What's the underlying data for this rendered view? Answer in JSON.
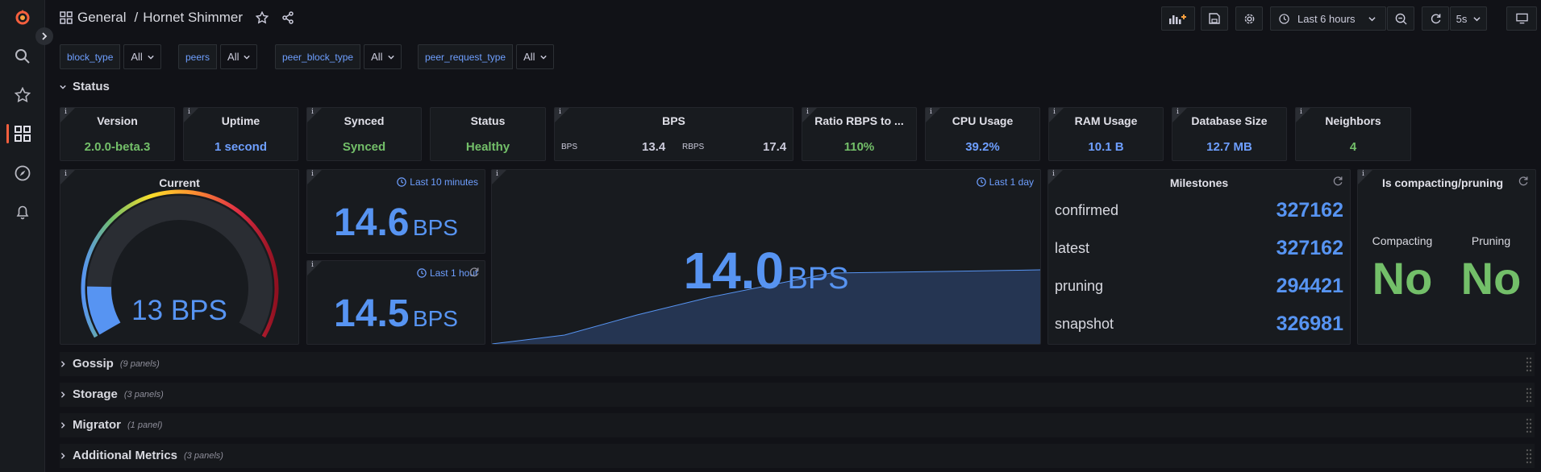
{
  "breadcrumb": {
    "folder": "General",
    "separator": "/",
    "dashboard": "Hornet Shimmer"
  },
  "toolbar": {
    "time_range": "Last 6 hours",
    "refresh_interval": "5s"
  },
  "variables": [
    {
      "label": "block_type",
      "value": "All"
    },
    {
      "label": "peers",
      "value": "All"
    },
    {
      "label": "peer_block_type",
      "value": "All"
    },
    {
      "label": "peer_request_type",
      "value": "All"
    }
  ],
  "status_row": {
    "title": "Status"
  },
  "stats": {
    "version": {
      "title": "Version",
      "value": "2.0.0-beta.3"
    },
    "uptime": {
      "title": "Uptime",
      "value": "1 second"
    },
    "synced": {
      "title": "Synced",
      "value": "Synced"
    },
    "status": {
      "title": "Status",
      "value": "Healthy"
    },
    "bps": {
      "title": "BPS",
      "bps_label": "BPS",
      "bps_value": "13.4",
      "rbps_label": "RBPS",
      "rbps_value": "17.4"
    },
    "ratio": {
      "title": "Ratio RBPS to ...",
      "value": "110%"
    },
    "cpu": {
      "title": "CPU Usage",
      "value": "39.2%"
    },
    "ram": {
      "title": "RAM Usage",
      "value": "10.1 B"
    },
    "db": {
      "title": "Database Size",
      "value": "12.7 MB"
    },
    "neighbors": {
      "title": "Neighbors",
      "value": "4"
    }
  },
  "gauge": {
    "title": "Current",
    "value": "13",
    "unit": "BPS",
    "level": 0.13
  },
  "bps10": {
    "time": "Last 10 minutes",
    "value": "14.6",
    "unit": "BPS"
  },
  "bps1h": {
    "time": "Last 1 hour",
    "value": "14.5",
    "unit": "BPS"
  },
  "bpsday": {
    "time": "Last 1 day",
    "value": "14.0",
    "unit": "BPS"
  },
  "milestones": {
    "title": "Milestones",
    "rows": [
      {
        "name": "confirmed",
        "value": "327162"
      },
      {
        "name": "latest",
        "value": "327162"
      },
      {
        "name": "pruning",
        "value": "294421"
      },
      {
        "name": "snapshot",
        "value": "326981"
      }
    ]
  },
  "compacting": {
    "title": "Is compacting/pruning",
    "c_label": "Compacting",
    "c_value": "No",
    "p_label": "Pruning",
    "p_value": "No"
  },
  "rows": [
    {
      "title": "Gossip",
      "count": "(9 panels)"
    },
    {
      "title": "Storage",
      "count": "(3 panels)"
    },
    {
      "title": "Migrator",
      "count": "(1 panel)"
    },
    {
      "title": "Additional Metrics",
      "count": "(3 panels)"
    }
  ],
  "colors": {
    "accent_blue": "#5794f2",
    "green": "#73bf69",
    "brand": "#f55f3e"
  }
}
